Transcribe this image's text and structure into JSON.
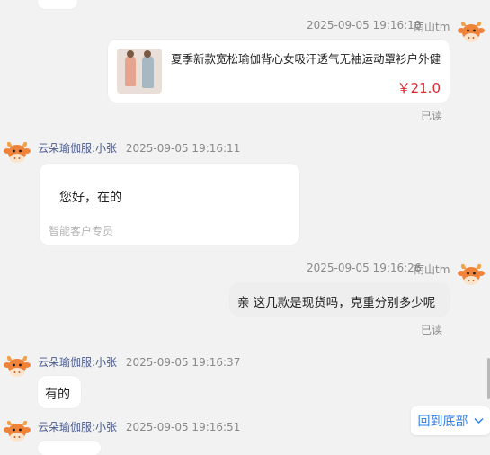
{
  "messages": {
    "top_stub": {},
    "m1": {
      "time": "2025-09-05 19:16:10",
      "sender": "南山tm",
      "product_title": "夏季新款宽松瑜伽背心女吸汗透气无袖运动罩衫户外健...",
      "price": "￥21.0",
      "status": "已读"
    },
    "m2": {
      "sender": "云朵瑜伽服:小张",
      "time": "2025-09-05 19:16:11",
      "text": "您好，在的",
      "footer": "智能客户专员"
    },
    "m3": {
      "time": "2025-09-05 19:16:26",
      "sender": "南山tm",
      "text": "亲 这几款是现货吗，克重分别多少呢",
      "status": "已读"
    },
    "m4": {
      "sender": "云朵瑜伽服:小张",
      "time": "2025-09-05 19:16:37",
      "text": "有的"
    },
    "m5": {
      "sender": "云朵瑜伽服:小张",
      "time": "2025-09-05 19:16:51"
    }
  },
  "back_to_bottom": {
    "label": "回到底部"
  },
  "colors": {
    "accent_blue": "#2f7fe8",
    "price_red": "#e0282e",
    "name_blue": "#4a5a8c"
  }
}
